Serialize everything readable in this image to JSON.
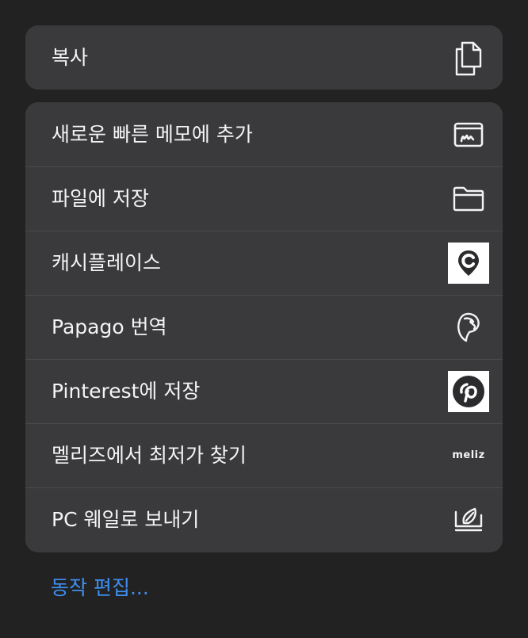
{
  "copy_group": {
    "label": "복사",
    "icon": "copy-icon"
  },
  "actions": [
    {
      "label": "새로운 빠른 메모에 추가",
      "icon": "quick-note-icon"
    },
    {
      "label": "파일에 저장",
      "icon": "folder-icon"
    },
    {
      "label": "캐시플레이스",
      "icon": "cashplace-logo-icon"
    },
    {
      "label": "Papago 번역",
      "icon": "papago-parrot-icon"
    },
    {
      "label": "Pinterest에 저장",
      "icon": "pinterest-logo-icon"
    },
    {
      "label": "멜리즈에서 최저가 찾기",
      "icon": "meliz-logo-icon",
      "icon_text": "meliz"
    },
    {
      "label": "PC 웨일로 보내기",
      "icon": "whale-send-icon"
    }
  ],
  "edit_actions": {
    "label": "동작 편집..."
  },
  "colors": {
    "background": "#222223",
    "group": "#3a3a3c",
    "separator": "#4a4a4d",
    "text": "#f4f4f6",
    "link": "#3d8ff2"
  }
}
